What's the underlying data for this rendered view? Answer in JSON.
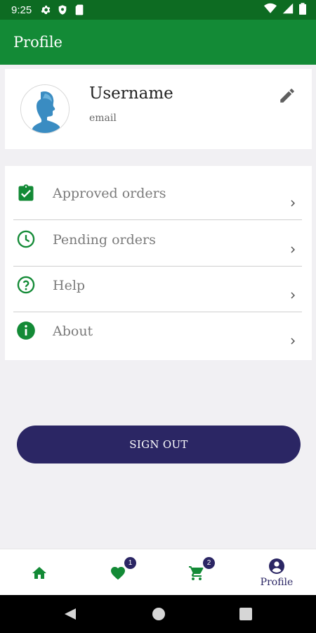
{
  "status_bar": {
    "time": "9:25",
    "icons": [
      "settings-icon",
      "shield-icon",
      "sim-card-icon",
      "wifi-icon",
      "signal-icon",
      "battery-icon"
    ]
  },
  "app_bar": {
    "title": "Profile"
  },
  "profile": {
    "username": "Username",
    "email": "email",
    "edit_icon": "pencil-icon"
  },
  "menu": {
    "items": [
      {
        "label": "Approved orders",
        "icon": "clipboard-check-icon"
      },
      {
        "label": "Pending orders",
        "icon": "clock-icon"
      },
      {
        "label": "Help",
        "icon": "help-circle-icon"
      },
      {
        "label": "About",
        "icon": "info-icon"
      }
    ]
  },
  "sign_out": {
    "label": "SIGN OUT"
  },
  "bottom_nav": {
    "items": [
      {
        "icon": "home-icon",
        "label": ""
      },
      {
        "icon": "heart-icon",
        "badge": "1",
        "label": ""
      },
      {
        "icon": "cart-icon",
        "badge": "2",
        "label": ""
      },
      {
        "icon": "profile-icon",
        "label": "Profile"
      }
    ]
  },
  "colors": {
    "primary": "#138a36",
    "primary_dark": "#0d6b22",
    "accent": "#2b2664",
    "background": "#f1f0f3"
  }
}
